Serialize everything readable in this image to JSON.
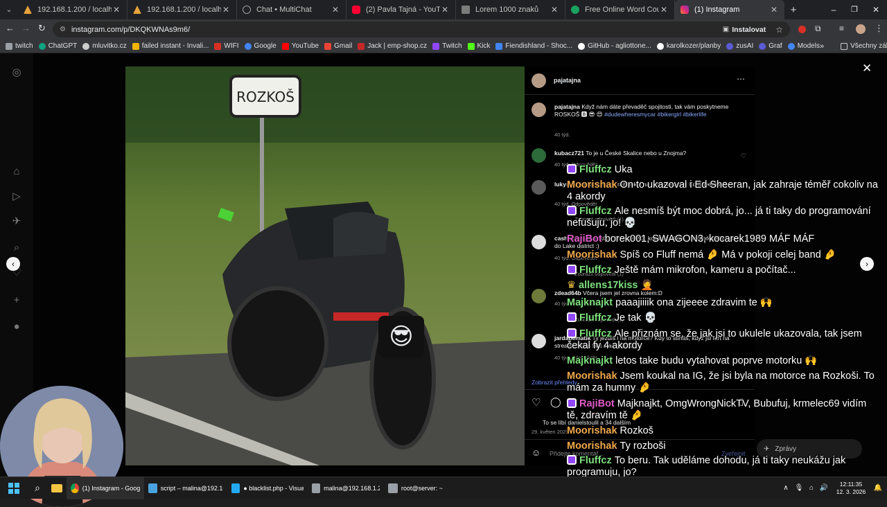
{
  "tabs": [
    {
      "title": "192.168.1.200 / localhost / mlu",
      "color": "#e6a23c"
    },
    {
      "title": "192.168.1.200 / localhost / mlu",
      "color": "#e6a23c"
    },
    {
      "title": "Chat • MultiChat",
      "color": "#9aa0a6"
    },
    {
      "title": "(2) Pavla Tajná - YouTube",
      "color": "#ff0033"
    },
    {
      "title": "Lorem 1000 znaků",
      "color": "#7c7c7c"
    },
    {
      "title": "Free Online Word Counter: Cou",
      "color": "#1aa260"
    },
    {
      "title": "(1) Instagram",
      "color": "#e1306c"
    }
  ],
  "address": {
    "url": "instagram.com/p/DKQKWNAs9m6/",
    "install_label": "Instalovat"
  },
  "bookmarks": [
    {
      "label": "twitch",
      "color": "#9146ff"
    },
    {
      "label": "ChatGPT",
      "color": "#10a37f"
    },
    {
      "label": "mluvitko.cz",
      "color": "#cccccc"
    },
    {
      "label": "failed instant - Invali...",
      "color": "#f4b400"
    },
    {
      "label": "WIFI",
      "color": "#d93025"
    },
    {
      "label": "Google",
      "color": "#4285f4"
    },
    {
      "label": "YouTube",
      "color": "#ff0000"
    },
    {
      "label": "Gmail",
      "color": "#ea4335"
    },
    {
      "label": "Jack | emp-shop.cz",
      "color": "#c62828"
    },
    {
      "label": "Twitch",
      "color": "#9146ff"
    },
    {
      "label": "Kick",
      "color": "#53fc18"
    },
    {
      "label": "Fiendishland - Shoc...",
      "color": "#4285f4"
    },
    {
      "label": "GitHub - agliottone...",
      "color": "#ffffff"
    },
    {
      "label": "karolkozer/planby",
      "color": "#ffffff"
    },
    {
      "label": "zusAI",
      "color": "#5b5bd6"
    },
    {
      "label": "Graf",
      "color": "#5b5bd6"
    },
    {
      "label": "Models",
      "color": "#4285f4"
    }
  ],
  "all_bookmarks_label": "Všechny záložky",
  "photo": {
    "sign_text": "ROZKOŠ",
    "emoji": "😎"
  },
  "post": {
    "username": "pajatajna",
    "caption_user": "pajatajna",
    "caption_text": "Když nám dáte převaděč spojitosti, tak vám poskytneme ROSKOŠ 🅱 😎 😍",
    "caption_tags": "#dudewheresmycar #bikergirl #bikerlife",
    "caption_time": "40 týd.",
    "comments": [
      {
        "user": "kubacz721",
        "text": "To je u České Skalice nebo u Znojma?",
        "meta": "40 týd.  Odpovědět"
      },
      {
        "user": "lukyn",
        "text": "Jo lebka To bude mít pokoj na… to ukazovat Ed Sheeran 😍",
        "meta": "40 týd.  Odpovědět",
        "more": "Zobrazit odpovědi (1)"
      },
      {
        "user": "cashmoney",
        "text": "bořek001 SWAGON3, kocarek 1989 … motorkářský výlet do Lake district :)",
        "meta": "40 týd.  Odpovědět",
        "more": "Zobrazit odpovědi (1)"
      },
      {
        "user": "zdead64b",
        "text": "Včera jsem jel zrovna kolem:D",
        "meta": "40 týd.  Odpovědět",
        "more": "Zobrazit odpovědi (1)"
      },
      {
        "user": "jardapematik",
        "text": "Ty jezdíš i na motorce? Kdy to stíháš, když jsi furt na streamu? Seš fakt sračk 😍 😍",
        "meta": "40 týd.  Odpovědět"
      }
    ],
    "show_insights": "Zobrazit přehledy",
    "likes_text": "To se líbí danielstoulil a 34 dalším",
    "date": "29. květen 2025",
    "add_comment_placeholder": "Přidejte komentář...",
    "publish_label": "Zveřejnit",
    "dm_label": "Zprávy"
  },
  "chat": [
    {
      "name": "Fluffcz",
      "color": "#7ee07e",
      "badge": true,
      "text": "Uka"
    },
    {
      "name": "Moorishak",
      "color": "#f0a84c",
      "badge": false,
      "text": "On to ukazoval i Ed Sheeran, jak zahraje téměř cokoliv na 4 akordy"
    },
    {
      "name": "Fluffcz",
      "color": "#7ee07e",
      "badge": true,
      "text": "Ale nesmíš být moc dobrá, jo... já ti taky do programování nefušuju, jo! 💀"
    },
    {
      "name": "RajiBot",
      "color": "#e05cc8",
      "badge": false,
      "text": "borek001, SWAGON3, kocarek1989 MÁF MÁF"
    },
    {
      "name": "Moorishak",
      "color": "#f0a84c",
      "badge": false,
      "text": "Spíš co Fluff nemá 🤌 Má v pokoji celej band 🤌"
    },
    {
      "name": "Fluffcz",
      "color": "#7ee07e",
      "badge": true,
      "text": "Ještě mám mikrofon, kameru a počítač..."
    },
    {
      "name": "allens17kiss",
      "color": "#7ee07e",
      "badge": false,
      "text": "🤦"
    },
    {
      "name": "Majknajkt",
      "color": "#7ee07e",
      "badge": false,
      "text": "paaajiiiik ona zijeeee zdravim te 🙌"
    },
    {
      "name": "Fluffcz",
      "color": "#7ee07e",
      "badge": true,
      "text": "Je tak 💀"
    },
    {
      "name": "Fluffcz",
      "color": "#7ee07e",
      "badge": true,
      "text": "Ale přiznám se, že jak jsi to ukulele ukazovala, tak jsem čekal fy 4 akordy"
    },
    {
      "name": "Majknajkt",
      "color": "#7ee07e",
      "badge": false,
      "text": "letos take budu vytahovat poprve motorku 🙌"
    },
    {
      "name": "Moorishak",
      "color": "#f0a84c",
      "badge": false,
      "text": "Jsem koukal na IG, že jsi byla na motorce na Rozkoši. To mám za humny 🤌"
    },
    {
      "name": "RajiBot",
      "color": "#e05cc8",
      "badge": true,
      "text": "Majknajkt, OmgWrongNickTV, Bubufuj, krmelec69 vidím tě, zdravím tě 🤌"
    },
    {
      "name": "Moorishak",
      "color": "#f0a84c",
      "badge": false,
      "text": "Rozkoš"
    },
    {
      "name": "Moorishak",
      "color": "#f0a84c",
      "badge": false,
      "text": "Ty rozboši"
    },
    {
      "name": "Fluffcz",
      "color": "#7ee07e",
      "badge": true,
      "text": "To beru. Tak uděláme dohodu, já ti taky neukážu jak programuju, jo?"
    }
  ],
  "taskbar": {
    "apps": [
      {
        "label": "(1) Instagram - Google C",
        "color": "#e8eaed"
      },
      {
        "label": "script – malina@192.168",
        "color": "#4aa3df"
      },
      {
        "label": "● blacklist.php - Visual S",
        "color": "#23a9f2"
      },
      {
        "label": "malina@192.168.1.200",
        "color": "#9aa0a6"
      },
      {
        "label": "root@server: ~",
        "color": "#9aa0a6"
      }
    ],
    "time": "12:11:35",
    "date": "12. 3. 2026"
  }
}
